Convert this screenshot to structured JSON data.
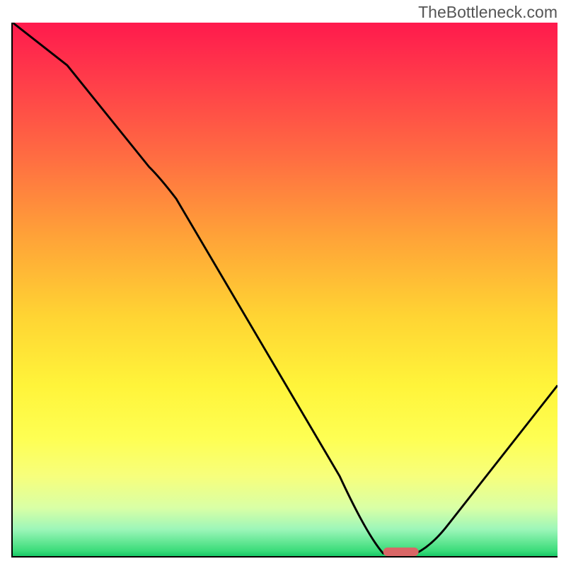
{
  "watermark": "TheBottleneck.com",
  "chart_data": {
    "type": "line",
    "title": "",
    "xlabel": "",
    "ylabel": "",
    "xlim": [
      0,
      100
    ],
    "ylim": [
      0,
      100
    ],
    "x": [
      0,
      10,
      25,
      30,
      60,
      66,
      70,
      74,
      80,
      100
    ],
    "y": [
      100,
      92,
      73,
      67,
      15,
      2,
      0,
      0,
      3,
      32
    ],
    "marker": {
      "x_range": [
        68,
        74
      ],
      "y": 0
    },
    "background": "gradient red→yellow→green (vertical)",
    "notes": "V-shaped curve; minimum near x≈70; thin green band at the very bottom indicates optimal region; small red pill marks the minimum on the x-axis."
  }
}
